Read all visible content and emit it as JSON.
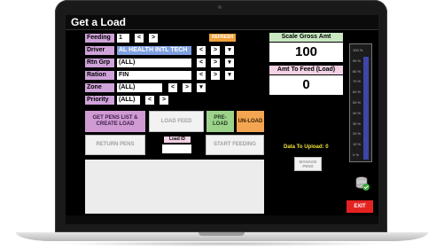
{
  "window": {
    "title": "Get a Load"
  },
  "form": {
    "feeding": {
      "label": "Feeding",
      "value": "1"
    },
    "driver": {
      "label": "Driver",
      "value": "AL HEALTH INTL TECH"
    },
    "rtn_grp": {
      "label": "Rtn Grp",
      "value": "(ALL)"
    },
    "ration": {
      "label": "Ration",
      "value": "FIN"
    },
    "zone": {
      "label": "Zone",
      "value": "(ALL)"
    },
    "priority": {
      "label": "Priority",
      "value": "(ALL)"
    },
    "nav_prev": "<",
    "nav_next": ">",
    "dropdown": "▾",
    "refresh_label": "REFRESH"
  },
  "scale": {
    "gross_label": "Scale Gross Amt",
    "gross_value": "100",
    "feed_label": "Amt To Feed (Load)",
    "feed_value": "0"
  },
  "buttons": {
    "get_pens": "GET PENS LIST & CREATE LOAD",
    "load_feed": "LOAD FEED",
    "pre_load": "PRE-LOAD",
    "unload": "UN-LOAD",
    "return_pens": "RETURN PENS",
    "load_id_label": "Load ID",
    "start_feeding": "START FEEDING",
    "manage_pens": "MANAGE PENS",
    "exit": "EXIT"
  },
  "status": {
    "upload_text": "Data To Upload: 0"
  },
  "gauge": {
    "ticks": [
      "100 %",
      "90 %",
      "80 %",
      "70 %",
      "60 %",
      "50 %",
      "40 %",
      "30 %",
      "20 %",
      "10 %",
      "0 %"
    ],
    "fill_fraction": 0.92,
    "bar_color": "#3d45a8"
  },
  "icons": {
    "db": "database-sync-icon"
  }
}
